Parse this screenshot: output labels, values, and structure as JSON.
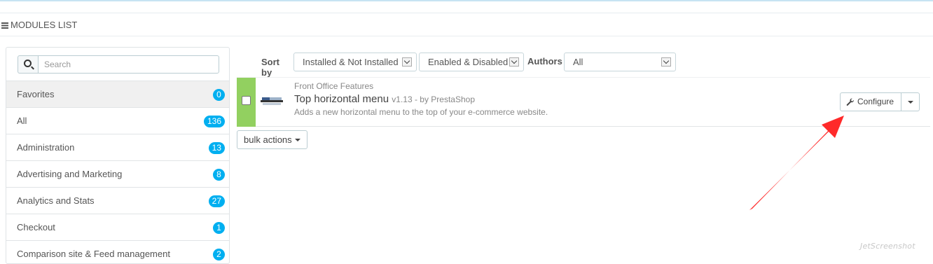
{
  "panel": {
    "title": "MODULES LIST"
  },
  "search": {
    "placeholder": "Search"
  },
  "categories": [
    {
      "label": "Favorites",
      "count": "0"
    },
    {
      "label": "All",
      "count": "136"
    },
    {
      "label": "Administration",
      "count": "13"
    },
    {
      "label": "Advertising and Marketing",
      "count": "8"
    },
    {
      "label": "Analytics and Stats",
      "count": "27"
    },
    {
      "label": "Checkout",
      "count": "1"
    },
    {
      "label": "Comparison site & Feed management",
      "count": "2"
    }
  ],
  "sort": {
    "label": "Sort by",
    "install_filter": "Installed & Not Installed",
    "status_filter": "Enabled & Disabled",
    "authors_label": "Authors",
    "authors_value": "All"
  },
  "module": {
    "category": "Front Office Features",
    "name": "Top horizontal menu",
    "version_author": "v1.13 - by PrestaShop",
    "description": "Adds a new horizontal menu to the top of your e-commerce website.",
    "configure_label": "Configure",
    "status_color": "#92d060"
  },
  "bulk": {
    "label": "bulk actions"
  },
  "watermark": {
    "text": "JetScreenshot"
  },
  "colors": {
    "badge": "#00aff0",
    "arrow": "#ff2a2a"
  }
}
